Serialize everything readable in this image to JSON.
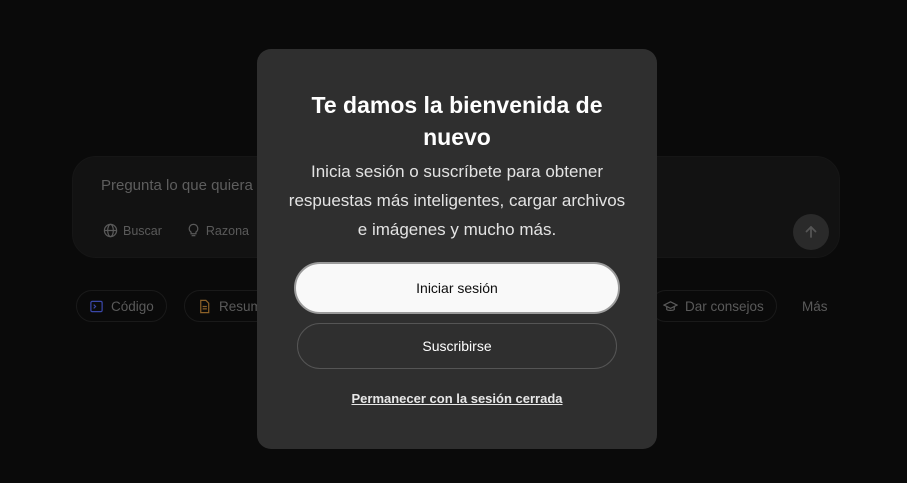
{
  "background": {
    "composer": {
      "placeholder": "Pregunta lo que quiera",
      "tools": [
        {
          "label": "Buscar",
          "icon": "globe-icon"
        },
        {
          "label": "Razona",
          "icon": "lightbulb-icon"
        }
      ],
      "send_icon": "arrow-up-icon"
    },
    "chips": [
      {
        "label": "Código",
        "icon": "code-icon",
        "color": "#4b5bd6"
      },
      {
        "label": "Resum",
        "icon": "document-icon",
        "color": "#c98a3b"
      },
      {
        "label": "Dar consejos",
        "icon": "graduation-cap-icon",
        "color": "#6a8fd6"
      },
      {
        "label": "Más",
        "icon": ""
      }
    ]
  },
  "modal": {
    "title": "Te damos la bienvenida de nuevo",
    "subtitle": "Inicia sesión o suscríbete para obtener respuestas más inteligentes, cargar archivos e imágenes y mucho más.",
    "login_label": "Iniciar sesión",
    "subscribe_label": "Suscribirse",
    "stay_logged_out_label": "Permanecer con la sesión cerrada"
  },
  "colors": {
    "page_bg": "#0a0a0a",
    "modal_bg": "#2f2f2f",
    "primary_button_bg": "#f9f9f9",
    "text_primary": "#ffffff"
  }
}
